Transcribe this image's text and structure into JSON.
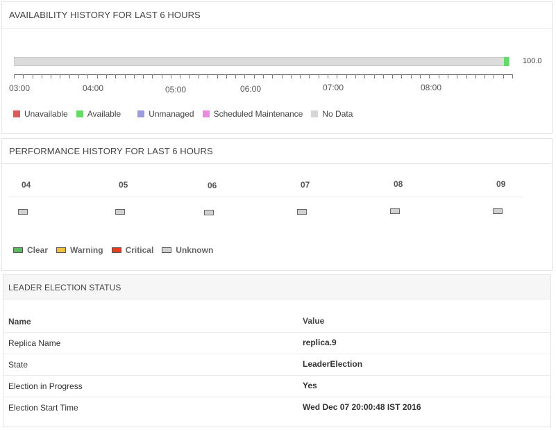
{
  "availability": {
    "title": "AVAILABILITY HISTORY FOR LAST 6 HOURS",
    "value": "100.0",
    "available_fraction": 0.01,
    "time_labels": [
      "03:00",
      "04:00",
      "05:00",
      "06:00",
      "07:00",
      "08:00"
    ],
    "legend": [
      {
        "label": "Unavailable",
        "color": "#e05a5a"
      },
      {
        "label": "Available",
        "color": "#66d966"
      },
      {
        "label": "Unmanaged",
        "color": "#9b9be0"
      },
      {
        "label": "Scheduled Maintenance",
        "color": "#e88ae8"
      },
      {
        "label": "No Data",
        "color": "#d6d6d6"
      }
    ]
  },
  "performance": {
    "title": "PERFORMANCE HISTORY FOR LAST 6 HOURS",
    "hours": [
      "04",
      "05",
      "06",
      "07",
      "08",
      "09"
    ],
    "legend": [
      {
        "label": "Clear",
        "color": "#5cb85c"
      },
      {
        "label": "Warning",
        "color": "#f0c040"
      },
      {
        "label": "Critical",
        "color": "#e04020"
      },
      {
        "label": "Unknown",
        "color": "#d0d0d0"
      }
    ]
  },
  "leader": {
    "title": "LEADER ELECTION STATUS",
    "header": {
      "name": "Name",
      "value": "Value"
    },
    "rows": [
      {
        "name": "Replica Name",
        "value": "replica.9"
      },
      {
        "name": "State",
        "value": "LeaderElection"
      },
      {
        "name": "Election in Progress",
        "value": "Yes"
      },
      {
        "name": "Election Start Time",
        "value": "Wed Dec 07 20:00:48 IST 2016"
      }
    ]
  }
}
